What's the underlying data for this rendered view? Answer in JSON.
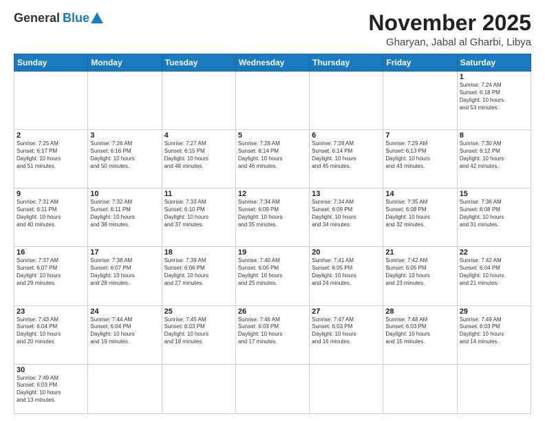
{
  "header": {
    "logo_general": "General",
    "logo_blue": "Blue",
    "title": "November 2025",
    "subtitle": "Gharyan, Jabal al Gharbi, Libya"
  },
  "days_of_week": [
    "Sunday",
    "Monday",
    "Tuesday",
    "Wednesday",
    "Thursday",
    "Friday",
    "Saturday"
  ],
  "weeks": [
    [
      {
        "day": "",
        "info": ""
      },
      {
        "day": "",
        "info": ""
      },
      {
        "day": "",
        "info": ""
      },
      {
        "day": "",
        "info": ""
      },
      {
        "day": "",
        "info": ""
      },
      {
        "day": "",
        "info": ""
      },
      {
        "day": "1",
        "info": "Sunrise: 7:24 AM\nSunset: 6:18 PM\nDaylight: 10 hours\nand 53 minutes."
      }
    ],
    [
      {
        "day": "2",
        "info": "Sunrise: 7:25 AM\nSunset: 6:17 PM\nDaylight: 10 hours\nand 51 minutes."
      },
      {
        "day": "3",
        "info": "Sunrise: 7:26 AM\nSunset: 6:16 PM\nDaylight: 10 hours\nand 50 minutes."
      },
      {
        "day": "4",
        "info": "Sunrise: 7:27 AM\nSunset: 6:15 PM\nDaylight: 10 hours\nand 48 minutes."
      },
      {
        "day": "5",
        "info": "Sunrise: 7:28 AM\nSunset: 6:14 PM\nDaylight: 10 hours\nand 46 minutes."
      },
      {
        "day": "6",
        "info": "Sunrise: 7:28 AM\nSunset: 6:14 PM\nDaylight: 10 hours\nand 45 minutes."
      },
      {
        "day": "7",
        "info": "Sunrise: 7:29 AM\nSunset: 6:13 PM\nDaylight: 10 hours\nand 43 minutes."
      },
      {
        "day": "8",
        "info": "Sunrise: 7:30 AM\nSunset: 6:12 PM\nDaylight: 10 hours\nand 42 minutes."
      }
    ],
    [
      {
        "day": "9",
        "info": "Sunrise: 7:31 AM\nSunset: 6:11 PM\nDaylight: 10 hours\nand 40 minutes."
      },
      {
        "day": "10",
        "info": "Sunrise: 7:32 AM\nSunset: 6:11 PM\nDaylight: 10 hours\nand 38 minutes."
      },
      {
        "day": "11",
        "info": "Sunrise: 7:33 AM\nSunset: 6:10 PM\nDaylight: 10 hours\nand 37 minutes."
      },
      {
        "day": "12",
        "info": "Sunrise: 7:34 AM\nSunset: 6:09 PM\nDaylight: 10 hours\nand 35 minutes."
      },
      {
        "day": "13",
        "info": "Sunrise: 7:34 AM\nSunset: 6:09 PM\nDaylight: 10 hours\nand 34 minutes."
      },
      {
        "day": "14",
        "info": "Sunrise: 7:35 AM\nSunset: 6:08 PM\nDaylight: 10 hours\nand 32 minutes."
      },
      {
        "day": "15",
        "info": "Sunrise: 7:36 AM\nSunset: 6:08 PM\nDaylight: 10 hours\nand 31 minutes."
      }
    ],
    [
      {
        "day": "16",
        "info": "Sunrise: 7:37 AM\nSunset: 6:07 PM\nDaylight: 10 hours\nand 29 minutes."
      },
      {
        "day": "17",
        "info": "Sunrise: 7:38 AM\nSunset: 6:07 PM\nDaylight: 10 hours\nand 28 minutes."
      },
      {
        "day": "18",
        "info": "Sunrise: 7:39 AM\nSunset: 6:06 PM\nDaylight: 10 hours\nand 27 minutes."
      },
      {
        "day": "19",
        "info": "Sunrise: 7:40 AM\nSunset: 6:06 PM\nDaylight: 10 hours\nand 25 minutes."
      },
      {
        "day": "20",
        "info": "Sunrise: 7:41 AM\nSunset: 6:05 PM\nDaylight: 10 hours\nand 24 minutes."
      },
      {
        "day": "21",
        "info": "Sunrise: 7:42 AM\nSunset: 6:05 PM\nDaylight: 10 hours\nand 23 minutes."
      },
      {
        "day": "22",
        "info": "Sunrise: 7:42 AM\nSunset: 6:04 PM\nDaylight: 10 hours\nand 21 minutes."
      }
    ],
    [
      {
        "day": "23",
        "info": "Sunrise: 7:43 AM\nSunset: 6:04 PM\nDaylight: 10 hours\nand 20 minutes."
      },
      {
        "day": "24",
        "info": "Sunrise: 7:44 AM\nSunset: 6:04 PM\nDaylight: 10 hours\nand 19 minutes."
      },
      {
        "day": "25",
        "info": "Sunrise: 7:45 AM\nSunset: 6:03 PM\nDaylight: 10 hours\nand 18 minutes."
      },
      {
        "day": "26",
        "info": "Sunrise: 7:46 AM\nSunset: 6:03 PM\nDaylight: 10 hours\nand 17 minutes."
      },
      {
        "day": "27",
        "info": "Sunrise: 7:47 AM\nSunset: 6:03 PM\nDaylight: 10 hours\nand 16 minutes."
      },
      {
        "day": "28",
        "info": "Sunrise: 7:48 AM\nSunset: 6:03 PM\nDaylight: 10 hours\nand 15 minutes."
      },
      {
        "day": "29",
        "info": "Sunrise: 7:49 AM\nSunset: 6:03 PM\nDaylight: 10 hours\nand 14 minutes."
      }
    ],
    [
      {
        "day": "30",
        "info": "Sunrise: 7:49 AM\nSunset: 6:03 PM\nDaylight: 10 hours\nand 13 minutes."
      },
      {
        "day": "",
        "info": ""
      },
      {
        "day": "",
        "info": ""
      },
      {
        "day": "",
        "info": ""
      },
      {
        "day": "",
        "info": ""
      },
      {
        "day": "",
        "info": ""
      },
      {
        "day": "",
        "info": ""
      }
    ]
  ]
}
